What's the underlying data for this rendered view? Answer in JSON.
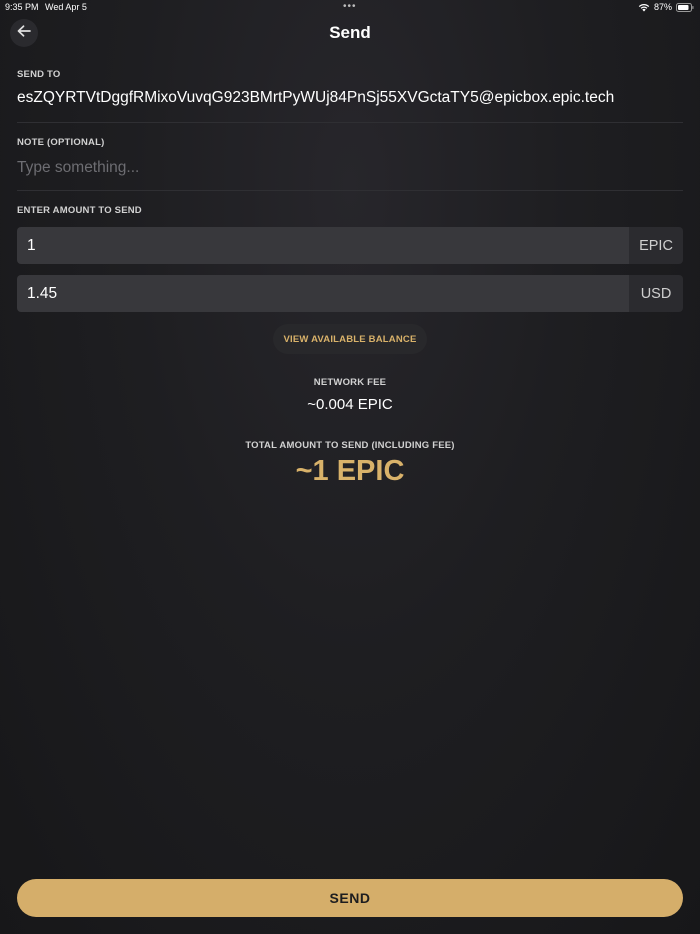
{
  "status_bar": {
    "time": "9:35 PM",
    "date": "Wed Apr 5",
    "dots": "•••",
    "battery": "87%"
  },
  "header": {
    "title": "Send",
    "back_icon": "arrow-left-icon"
  },
  "send_to": {
    "label": "SEND TO",
    "address": "esZQYRTVtDggfRMixoVuvqG923BMrtPyWUj84PnSj55XVGctaTY5@epicbox.epic.tech"
  },
  "note": {
    "label": "NOTE (OPTIONAL)",
    "placeholder": "Type something...",
    "value": ""
  },
  "amount": {
    "label": "ENTER AMOUNT TO SEND",
    "crypto_value": "1",
    "crypto_unit": "EPIC",
    "fiat_value": "1.45",
    "fiat_unit": "USD"
  },
  "balance_button": "VIEW AVAILABLE BALANCE",
  "fee": {
    "label": "NETWORK FEE",
    "value": "~0.004 EPIC"
  },
  "total": {
    "label": "TOTAL AMOUNT TO SEND (INCLUDING FEE)",
    "value": "~1 EPIC"
  },
  "send_button": "SEND",
  "colors": {
    "accent": "#d5ae6a",
    "background": "#1e1e21"
  }
}
